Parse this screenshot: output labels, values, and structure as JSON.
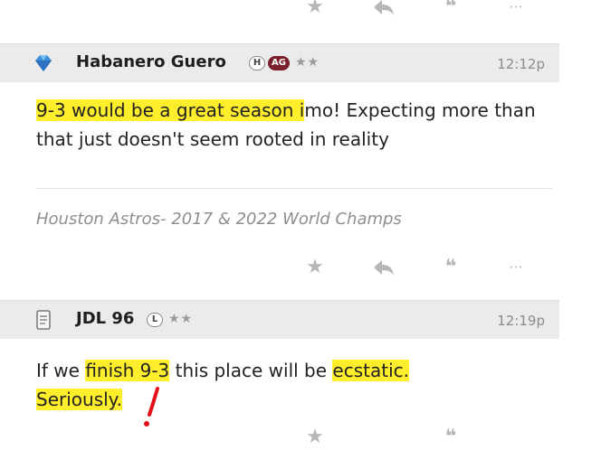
{
  "icons": {
    "star": "★",
    "reply": "reply-arrow-icon",
    "quote": "❝",
    "more": "···"
  },
  "post1": {
    "author": "Habanero Guero",
    "badges": [
      "H",
      "AG"
    ],
    "stars": "★★",
    "time": "12:12p",
    "text_highlighted": "9-3 would be a great season i",
    "text_rest": "mo! Expecting more than that just doesn't seem rooted in reality",
    "signature": "Houston Astros- 2017 & 2022 World Champs"
  },
  "post2": {
    "author": "JDL 96",
    "badges": [
      "L"
    ],
    "stars": "★★",
    "time": "12:19p",
    "t1": "If we ",
    "h1": "finish 9-3",
    "t2": " this place will be ",
    "h2": "ecstatic.",
    "h3": "Seriously."
  },
  "colors": {
    "highlight": "#ffee2b",
    "header_bg": "#ebebeb",
    "annotation": "#e3101a",
    "ag_badge": "#7a1e2c"
  }
}
